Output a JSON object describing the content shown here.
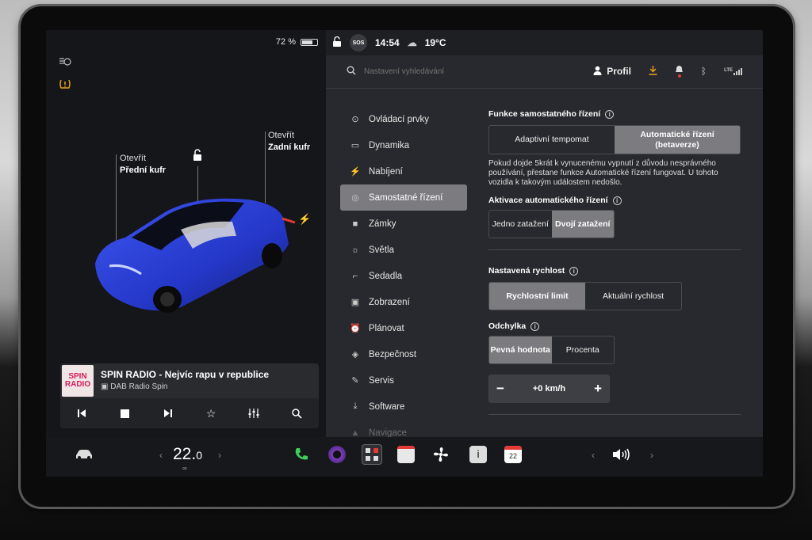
{
  "left": {
    "battery_percent": "72 %",
    "battery_level": 0.72,
    "callout_front": {
      "line1": "Otevřít",
      "line2": "Přední kufr"
    },
    "callout_rear": {
      "line1": "Otevřít",
      "line2": "Zadní kufr"
    }
  },
  "media": {
    "logo_top": "SPIN",
    "logo_bottom": "RADIO",
    "title": "SPIN RADIO - Nejvíc rapu v republice",
    "source": "DAB Radio Spin"
  },
  "status": {
    "sos": "SOS",
    "time": "14:54",
    "temperature": "19°C",
    "network": "LTE"
  },
  "search": {
    "placeholder": "Nastavení vyhledávání"
  },
  "profile": {
    "label": "Profil"
  },
  "nav": {
    "items": [
      {
        "label": "Ovládací prvky",
        "icon": "toggle-icon"
      },
      {
        "label": "Dynamika",
        "icon": "car-icon"
      },
      {
        "label": "Nabíjení",
        "icon": "bolt-icon"
      },
      {
        "label": "Samostatné řízení",
        "icon": "steering-wheel-icon"
      },
      {
        "label": "Zámky",
        "icon": "lock-icon"
      },
      {
        "label": "Světla",
        "icon": "sun-icon"
      },
      {
        "label": "Sedadla",
        "icon": "seat-icon"
      },
      {
        "label": "Zobrazení",
        "icon": "display-icon"
      },
      {
        "label": "Plánovat",
        "icon": "alarm-icon"
      },
      {
        "label": "Bezpečnost",
        "icon": "shield-icon"
      },
      {
        "label": "Servis",
        "icon": "wrench-icon"
      },
      {
        "label": "Software",
        "icon": "download-icon"
      },
      {
        "label": "Navigace",
        "icon": "navigation-icon"
      }
    ],
    "active": "Samostatné řízení"
  },
  "autopilot": {
    "features_title": "Funkce samostatného řízení",
    "features_options": [
      "Adaptivní tempomat",
      "Automatické řízení (betaverze)"
    ],
    "features_selected": "Automatické řízení (betaverze)",
    "description": "Pokud dojde 5krát k vynucenému vypnutí z důvodu nesprávného používání, přestane funkce Automatické řízení fungovat. U tohoto vozidla k takovým událostem nedošlo.",
    "activation_title": "Aktivace automatického řízení",
    "activation_options": [
      "Jedno zatažení",
      "Dvojí zatažení"
    ],
    "activation_selected": "Dvojí zatažení",
    "speed_title": "Nastavená rychlost",
    "speed_options": [
      "Rychlostní limit",
      "Aktuální rychlost"
    ],
    "speed_selected": "Rychlostní limit",
    "offset_title": "Odchylka",
    "offset_options": [
      "Pevná hodnota",
      "Procenta"
    ],
    "offset_selected": "Pevná hodnota",
    "offset_value": "+0 km/h",
    "minus": "−",
    "plus": "+"
  },
  "bottom": {
    "temperature_main": "22.",
    "temperature_decimal": "0",
    "calendar_day": "22"
  },
  "colors": {
    "accent_select": "#7b7b80",
    "phone": "#3ecf5a",
    "download": "#f0a21a",
    "alert_dot": "#e53935",
    "car_blue": "#2437c8",
    "seatbelt_warning": "#e3a21a"
  }
}
